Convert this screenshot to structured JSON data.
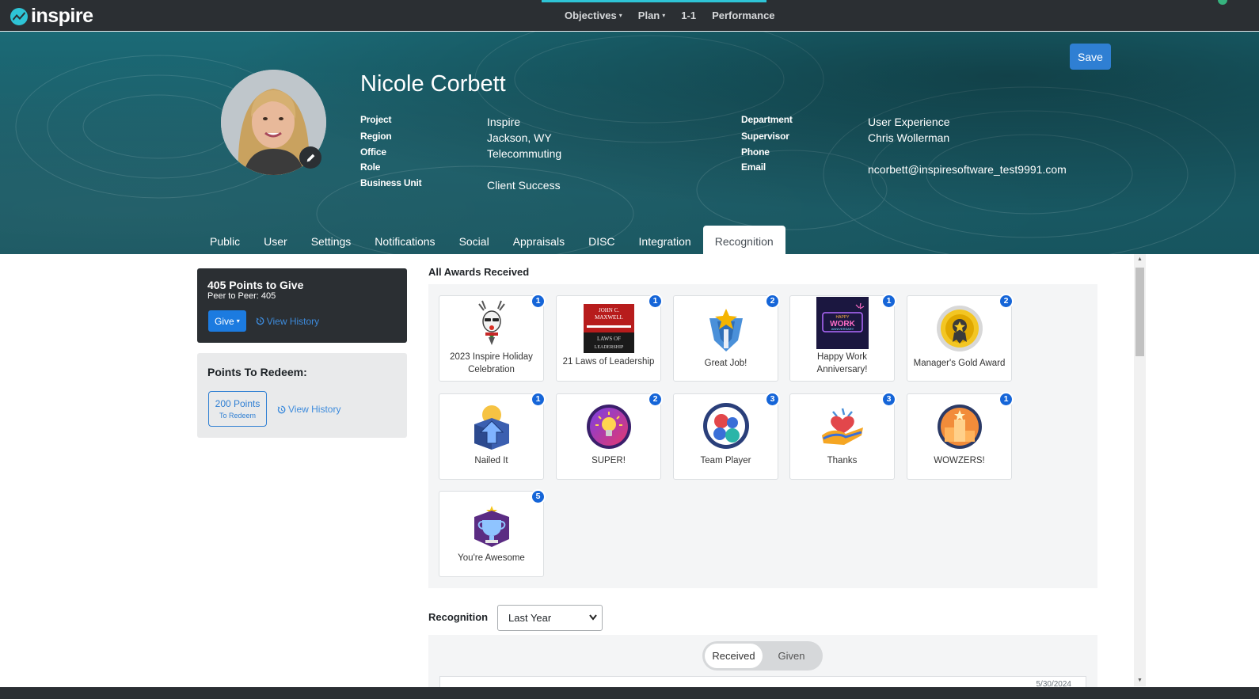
{
  "brand": {
    "name": "inspire"
  },
  "topnav": {
    "objectives": "Objectives",
    "plan": "Plan",
    "one_on_one": "1-1",
    "performance": "Performance",
    "caret": "▾"
  },
  "header": {
    "save_label": "Save",
    "name": "Nicole Corbett",
    "fields_left": [
      {
        "label": "Project",
        "value": "Inspire"
      },
      {
        "label": "Region",
        "value": "Jackson, WY"
      },
      {
        "label": "Office",
        "value": "Telecommuting"
      },
      {
        "label": "Role",
        "value": ""
      },
      {
        "label": "Business Unit",
        "value": "Client Success"
      }
    ],
    "fields_right": [
      {
        "label": "Department",
        "value": "User Experience"
      },
      {
        "label": "Supervisor",
        "value": "Chris Wollerman"
      },
      {
        "label": "Phone",
        "value": ""
      },
      {
        "label": "Email",
        "value": "ncorbett@inspiresoftware_test9991.com"
      }
    ]
  },
  "tabs": [
    {
      "label": "Public",
      "active": false
    },
    {
      "label": "User",
      "active": false
    },
    {
      "label": "Settings",
      "active": false
    },
    {
      "label": "Notifications",
      "active": false
    },
    {
      "label": "Social",
      "active": false
    },
    {
      "label": "Appraisals",
      "active": false
    },
    {
      "label": "DISC",
      "active": false
    },
    {
      "label": "Integration",
      "active": false
    },
    {
      "label": "Recognition",
      "active": true
    }
  ],
  "give_panel": {
    "title": "405 Points to Give",
    "subtitle": "Peer to Peer: 405",
    "give_label": "Give",
    "history_label": "View History"
  },
  "redeem_panel": {
    "title": "Points To Redeem:",
    "points": "200 Points",
    "points_sub": "To Redeem",
    "history_label": "View History"
  },
  "awards": {
    "title": "All Awards Received",
    "items": [
      {
        "label": "2023 Inspire Holiday Celebration",
        "count": "1",
        "icon": "reindeer-icon"
      },
      {
        "label": "21 Laws of Leadership",
        "count": "1",
        "icon": "book-cover-icon",
        "book_lines": [
          "JOHN C.",
          "MAXWELL",
          "LAWS OF",
          "LEADERSHIP"
        ]
      },
      {
        "label": "Great Job!",
        "count": "2",
        "icon": "star-trophy-icon"
      },
      {
        "label": "Happy Work Anniversary!",
        "count": "1",
        "icon": "neon-sign-icon",
        "sign_lines": [
          "HAPPY",
          "WORK",
          "ANNIVERSARY"
        ]
      },
      {
        "label": "Manager's Gold Award",
        "count": "2",
        "icon": "gold-medal-icon"
      },
      {
        "label": "Nailed It",
        "count": "1",
        "icon": "arrow-up-icon"
      },
      {
        "label": "SUPER!",
        "count": "2",
        "icon": "lightbulb-icon"
      },
      {
        "label": "Team Player",
        "count": "3",
        "icon": "team-icon"
      },
      {
        "label": "Thanks",
        "count": "3",
        "icon": "heart-hand-icon"
      },
      {
        "label": "WOWZERS!",
        "count": "1",
        "icon": "podium-icon"
      },
      {
        "label": "You're Awesome",
        "count": "5",
        "icon": "trophy-icon"
      }
    ]
  },
  "recognition": {
    "title": "Recognition",
    "period": "Last Year",
    "toggle": [
      "Received",
      "Given"
    ],
    "first_date": "5/30/2024"
  },
  "colors": {
    "accent": "#2f7fd3",
    "badge": "#1565d8",
    "header": "#1a5d68",
    "dark_panel": "#2b2f33"
  }
}
